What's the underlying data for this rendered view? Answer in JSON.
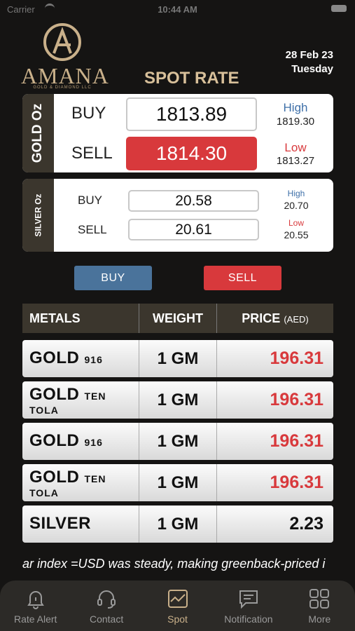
{
  "status_bar": {
    "carrier": "Carrier",
    "time": "10:44 AM"
  },
  "header": {
    "brand": "AMANA",
    "brand_sub": "GOLD & DIAMOND LLC",
    "title": "SPOT RATE",
    "date": "28 Feb 23",
    "day": "Tuesday"
  },
  "gold": {
    "side_label": "GOLD Oz",
    "buy_label": "BUY",
    "sell_label": "SELL",
    "buy_value": "1813.89",
    "sell_value": "1814.30",
    "high_label": "High",
    "high_value": "1819.30",
    "low_label": "Low",
    "low_value": "1813.27"
  },
  "silver": {
    "side_label": "SILVER Oz",
    "buy_label": "BUY",
    "sell_label": "SELL",
    "buy_value": "20.58",
    "sell_value": "20.61",
    "high_label": "High",
    "high_value": "20.70",
    "low_label": "Low",
    "low_value": "20.55"
  },
  "actions": {
    "buy": "BUY",
    "sell": "SELL"
  },
  "table": {
    "headers": {
      "metals": "METALS",
      "weight": "WEIGHT",
      "price": "PRICE",
      "price_unit": "(AED)"
    },
    "rows": [
      {
        "metal": "GOLD",
        "purity": "916",
        "sub": "",
        "weight": "1 GM",
        "price": "196.31"
      },
      {
        "metal": "GOLD",
        "purity": "TEN",
        "sub": "TOLA",
        "weight": "1 GM",
        "price": "196.31"
      },
      {
        "metal": "GOLD",
        "purity": "916",
        "sub": "",
        "weight": "1 GM",
        "price": "196.31"
      },
      {
        "metal": "GOLD",
        "purity": "TEN",
        "sub": "TOLA",
        "weight": "1 GM",
        "price": "196.31"
      },
      {
        "metal": "SILVER",
        "purity": "",
        "sub": "",
        "weight": "1 GM",
        "price": "2.23"
      }
    ]
  },
  "ticker": "ar index =USD was steady, making greenback-priced i",
  "tabs": [
    {
      "label": "Rate Alert",
      "icon": "bell-icon"
    },
    {
      "label": "Contact",
      "icon": "headset-icon"
    },
    {
      "label": "Spot",
      "icon": "chart-icon"
    },
    {
      "label": "Notification",
      "icon": "message-icon"
    },
    {
      "label": "More",
      "icon": "grid-icon"
    }
  ],
  "colors": {
    "gold_accent": "#c9b08a",
    "sell_red": "#d8393c",
    "buy_blue": "#4a739b",
    "panel_brown": "#3b362d"
  }
}
